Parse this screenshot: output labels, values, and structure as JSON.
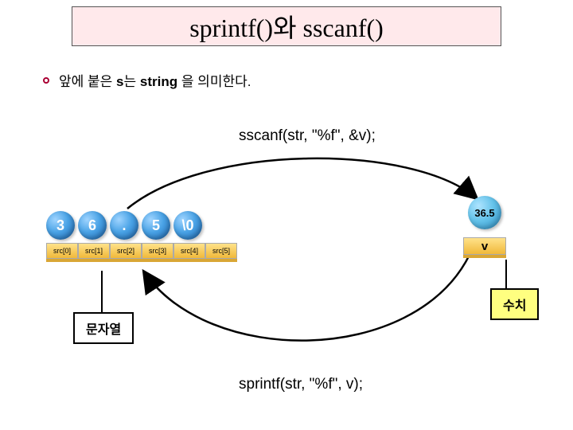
{
  "title": "sprintf()와 sscanf()",
  "bullet": {
    "prefix": "앞에 붙은 ",
    "strong1": "s",
    "mid": "는 ",
    "strong2": "string ",
    "suffix": "을 의미한다."
  },
  "code_top": "sscanf(str, \"%f\", &v);",
  "code_bottom": "sprintf(str, \"%f\", v);",
  "array": {
    "chars": [
      "3",
      "6",
      ".",
      "5",
      "\\0"
    ],
    "indices": [
      "src[0]",
      "src[1]",
      "src[2]",
      "src[3]",
      "src[4]",
      "src[5]"
    ]
  },
  "value": {
    "number": "36.5",
    "var": "v"
  },
  "label_string": "문자열",
  "label_number": "수치"
}
